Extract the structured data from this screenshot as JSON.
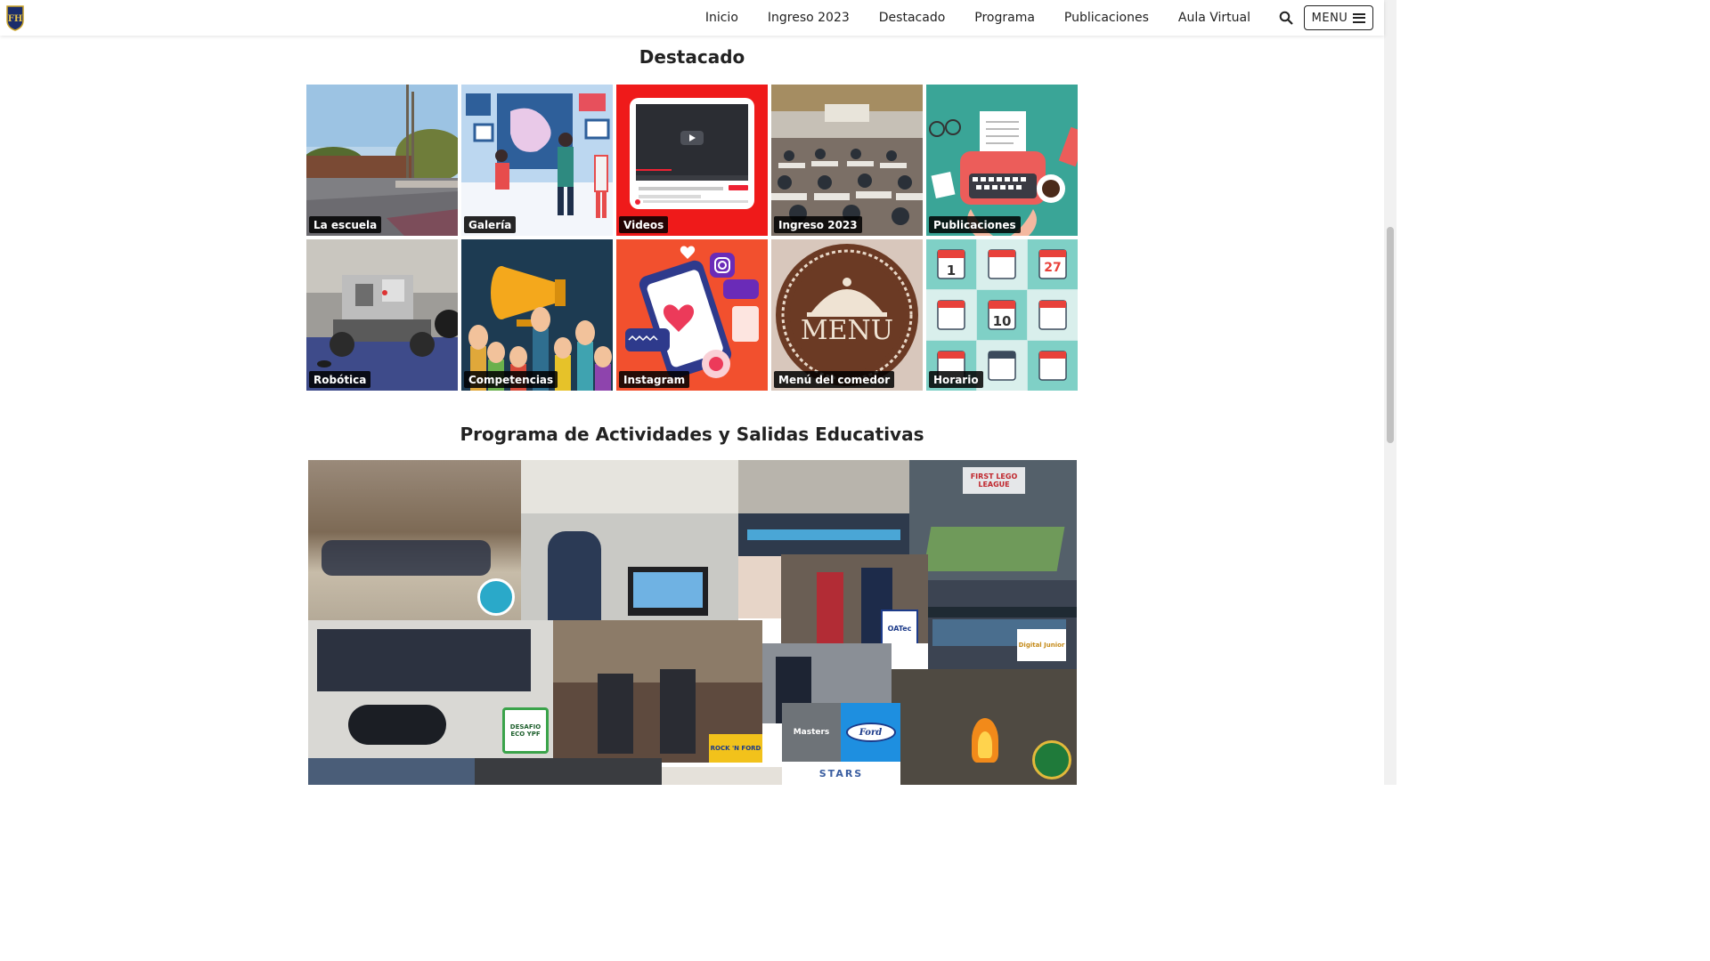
{
  "header": {
    "logo_text": "FH",
    "nav": [
      "Inicio",
      "Ingreso 2023",
      "Destacado",
      "Programa",
      "Publicaciones",
      "Aula Virtual"
    ],
    "menu_label": "MENU"
  },
  "destacado": {
    "title": "Destacado",
    "tiles": [
      {
        "label": "La escuela"
      },
      {
        "label": "Galería"
      },
      {
        "label": "Videos"
      },
      {
        "label": "Ingreso 2023"
      },
      {
        "label": "Publicaciones"
      },
      {
        "label": "Robótica"
      },
      {
        "label": "Competencias"
      },
      {
        "label": "Instagram"
      },
      {
        "label": "Menú del comedor"
      },
      {
        "label": "Horario"
      }
    ]
  },
  "programa": {
    "title": "Programa de Actividades y Salidas Educativas",
    "collage_logos": {
      "first_lego": "FIRST LEGO LEAGUE",
      "oatec": "OATec",
      "digital_junior": "Digital Junior",
      "desafio_eco": "DESAFIO ECO YPF",
      "rock_ford": "ROCK 'N FORD",
      "masters": "Masters",
      "ford": "Ford",
      "stars": "STARS"
    }
  },
  "calendar_numbers": [
    "1",
    "27",
    "10"
  ],
  "menu_plate_text": "MENU",
  "colors": {
    "videos_bg": "#ef1a1a",
    "publicaciones_bg": "#3aa597",
    "competencias_bg": "#1d3b52",
    "instagram_bg": "#f2502e",
    "menu_bg": "#d8c7bc",
    "horario_bg": "#7fd0c6"
  }
}
